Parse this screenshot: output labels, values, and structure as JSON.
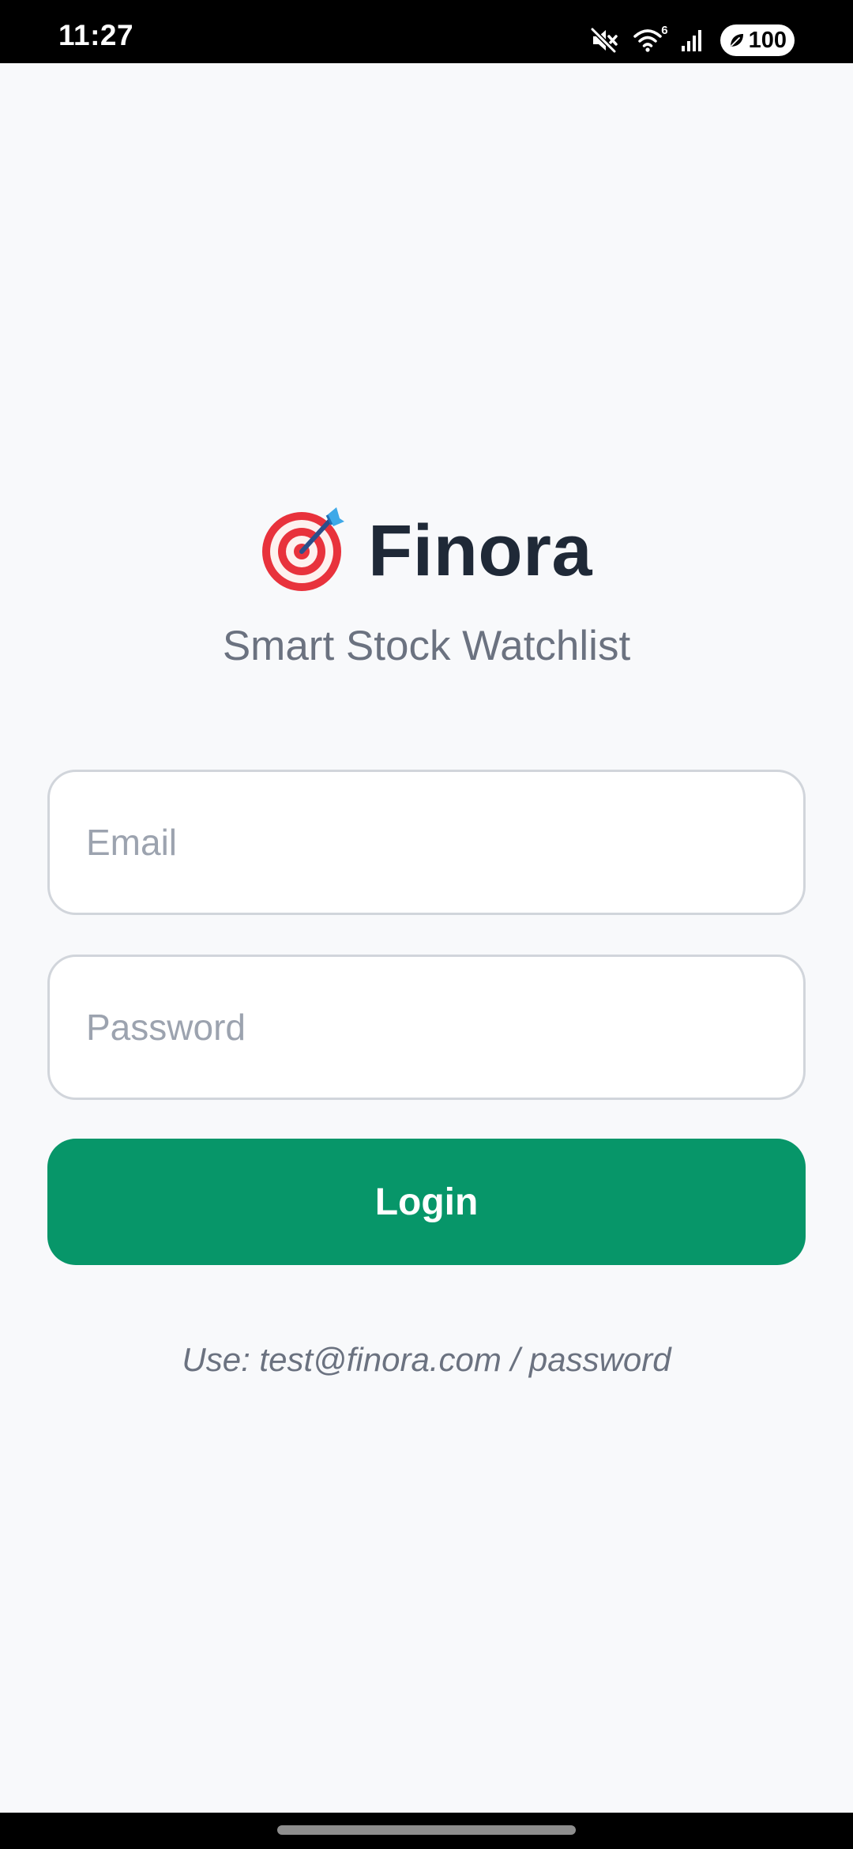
{
  "status_bar": {
    "time": "11:27",
    "icons": [
      "mute-icon",
      "wifi-icon",
      "signal-icon",
      "battery-icon"
    ],
    "wifi_badge": "6",
    "battery_level": "100"
  },
  "brand": {
    "logo_icon": "direct-hit-target-icon",
    "title": "Finora",
    "subtitle": "Smart Stock Watchlist"
  },
  "form": {
    "email_placeholder": "Email",
    "email_value": "",
    "password_placeholder": "Password",
    "password_value": "",
    "login_label": "Login"
  },
  "hint": "Use: test@finora.com / password",
  "colors": {
    "background": "#f8f9fb",
    "title": "#1f2937",
    "subtitle": "#6b7280",
    "accent": "#079669",
    "field_border": "#d1d5db",
    "placeholder": "#9ca3af"
  }
}
